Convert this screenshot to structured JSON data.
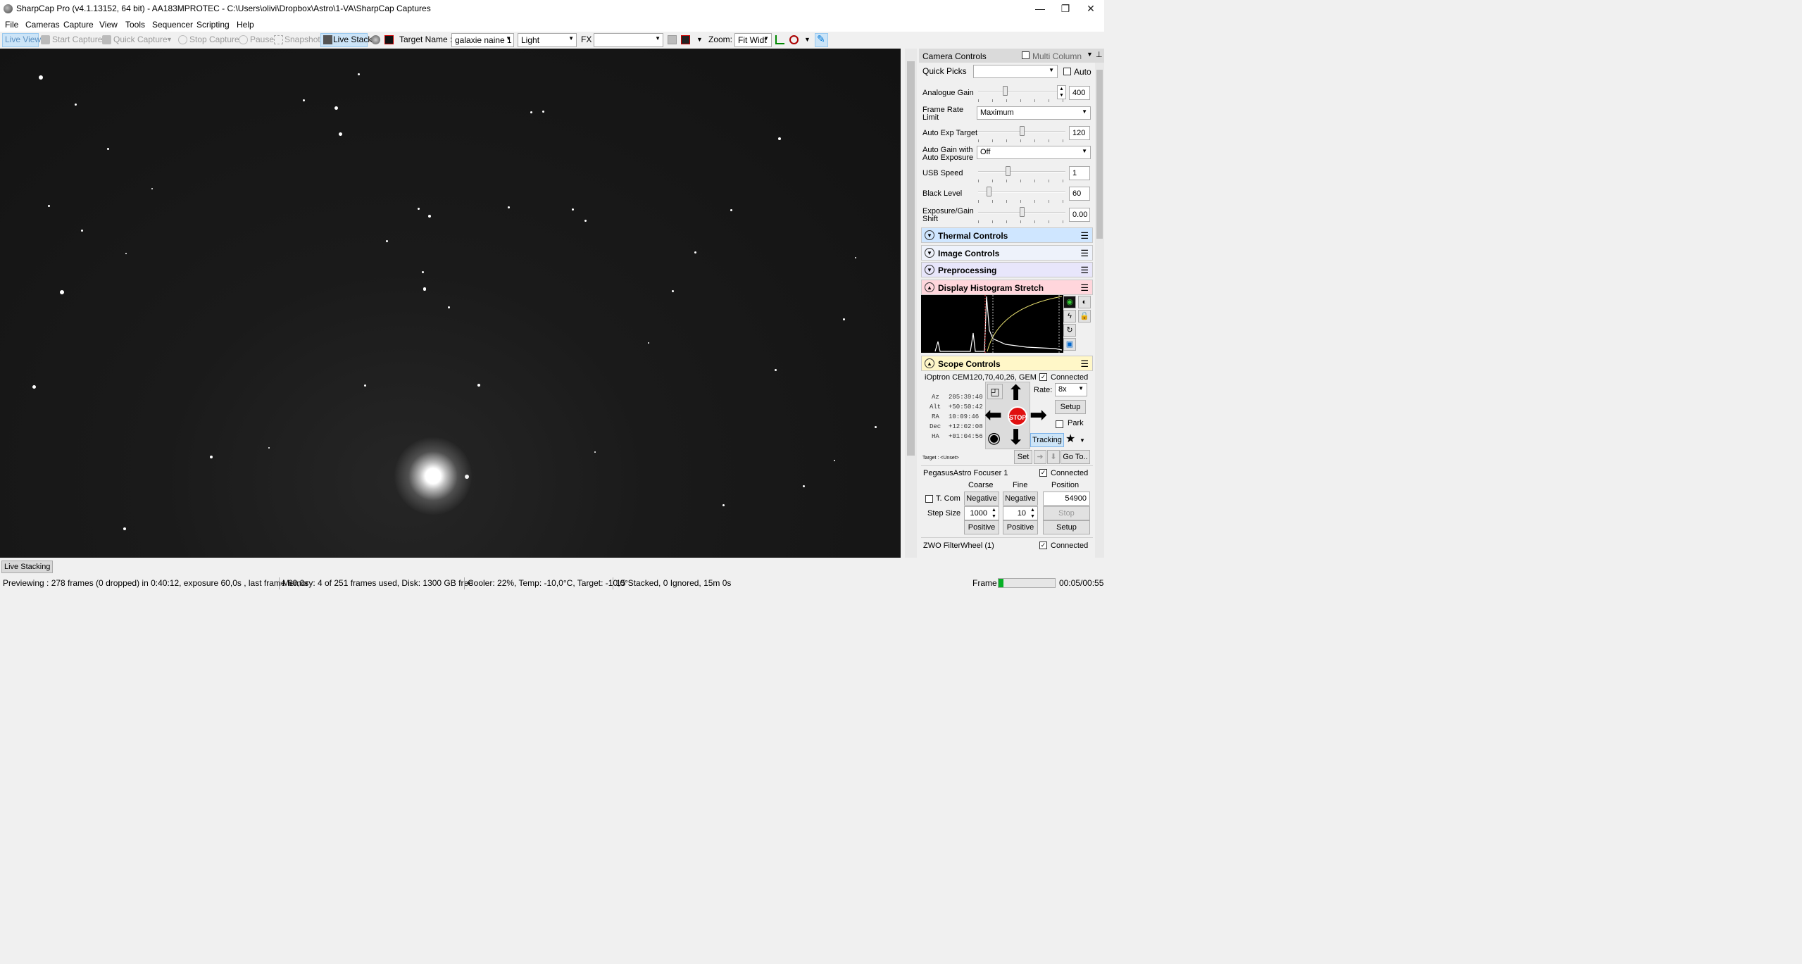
{
  "window": {
    "title": "SharpCap Pro (v4.1.13152, 64 bit) - AA183MPROTEC - C:\\Users\\olivi\\Dropbox\\Astro\\1-VA\\SharpCap Captures"
  },
  "menu": [
    "File",
    "Cameras",
    "Capture",
    "View",
    "Tools",
    "Sequencer",
    "Scripting",
    "Help"
  ],
  "toolbar": {
    "live_view": "Live View",
    "start_capture": "Start Capture",
    "quick_capture": "Quick Capture",
    "stop_capture": "Stop Capture",
    "pause": "Pause",
    "snapshot": "Snapshot",
    "live_stack": "Live Stack",
    "target_label": "Target Name :",
    "target_value": "galaxie naine 1",
    "frame_type": "Light",
    "fx_label": "FX",
    "fx_value": "",
    "zoom_label": "Zoom:",
    "zoom_value": "Fit Widt"
  },
  "panel": {
    "header": "Camera Controls",
    "multi_column": "Multi Column",
    "quick_picks": "Quick Picks",
    "auto": "Auto",
    "analogue_gain": {
      "label": "Analogue Gain",
      "value": "400",
      "level": 0.3
    },
    "frame_rate": {
      "label1": "Frame Rate",
      "label2": "Limit",
      "value": "Maximum"
    },
    "auto_exp": {
      "label": "Auto Exp Target",
      "value": "120",
      "level": 0.5
    },
    "auto_gain": {
      "label1": "Auto Gain with",
      "label2": "Auto Exposure",
      "value": "Off"
    },
    "usb_speed": {
      "label": "USB Speed",
      "value": "1",
      "level": 0.33
    },
    "black_level": {
      "label": "Black Level",
      "value": "60",
      "level": 0.1
    },
    "exposure_gain": {
      "label1": "Exposure/Gain",
      "label2": "Shift",
      "value": "0.00",
      "level": 0.5
    },
    "sections": {
      "thermal": "Thermal Controls",
      "image": "Image Controls",
      "preprocessing": "Preprocessing",
      "histogram": "Display Histogram Stretch",
      "scope": "Scope Controls"
    },
    "scope": {
      "mount": "iOptron CEM120,70,40,26, GEM",
      "connected": "Connected",
      "rate_label": "Rate:",
      "rate_value": "8x",
      "setup": "Setup",
      "park": "Park",
      "tracking": "Tracking",
      "stop": "STOP",
      "set": "Set",
      "goto": "Go To..",
      "target": "Target : <Unset>",
      "coords": [
        {
          "k": "Az",
          "v": "205:39:40"
        },
        {
          "k": "Alt",
          "v": "+50:50:42"
        },
        {
          "k": "RA",
          "v": "10:09:46"
        },
        {
          "k": "Dec",
          "v": "+12:02:08"
        },
        {
          "k": "HA",
          "v": "+01:04:56"
        }
      ]
    },
    "focuser": {
      "name": "PegasusAstro Focuser 1",
      "connected": "Connected",
      "coarse": "Coarse",
      "fine": "Fine",
      "position": "Position",
      "tcomp": "T. Com",
      "negative": "Negative",
      "position_value": "54900",
      "step_size": "Step Size",
      "step_coarse": "1000",
      "step_fine": "10",
      "stop": "Stop",
      "positive": "Positive",
      "setup": "Setup"
    },
    "filterwheel": {
      "name": "ZWO FilterWheel (1)",
      "connected": "Connected"
    }
  },
  "bottom": {
    "live_stacking": "Live Stacking"
  },
  "status": {
    "preview": "Previewing : 278 frames (0 dropped) in 0:40:12, exposure 60,0s , last frame 60,0s",
    "memory": "Memory: 4 of 251 frames used, Disk: 1300 GB free",
    "cooler": "Cooler: 22%, Temp: -10,0°C, Target: -10,0°",
    "stacked": "15 Stacked, 0 Ignored, 15m 0s",
    "frame": "Frame :",
    "time": "00:05/00:55"
  },
  "colors": {
    "accent": "#0078d7",
    "histogram_header": "#ffd6dc",
    "scope_header": "#fff7c8",
    "thermal_header": "#cfe6ff",
    "image_header": "#eef2fb",
    "preproc_header": "#e8e6fb",
    "tracking_bg": "#cce4f7",
    "stop_red": "#e01010"
  }
}
